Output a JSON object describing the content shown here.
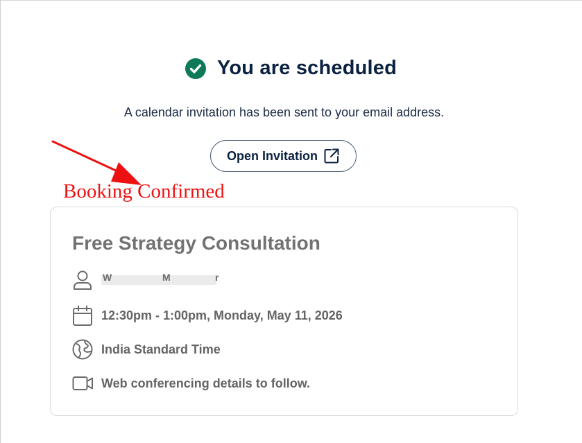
{
  "header": {
    "title": "You are scheduled",
    "subtitle": "A calendar invitation has been sent to your email address.",
    "open_button_label": "Open Invitation"
  },
  "annotation": {
    "text": "Booking Confirmed",
    "color": "#ee1111"
  },
  "event": {
    "name": "Free Strategy Consultation",
    "host": "",
    "time": "12:30pm - 1:00pm, Monday, May 11, 2026",
    "timezone": "India Standard Time",
    "conferencing": "Web conferencing details to follow."
  },
  "colors": {
    "accent_green": "#0f7a5a",
    "title_navy": "#0b2140",
    "muted_text": "#646464"
  },
  "icons": {
    "check": "check-circle-icon",
    "external": "external-link-icon",
    "person": "person-icon",
    "calendar": "calendar-icon",
    "globe": "globe-icon",
    "video": "video-camera-icon"
  }
}
